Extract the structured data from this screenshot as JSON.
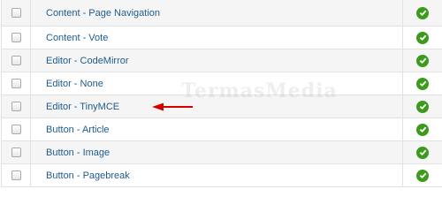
{
  "watermark": "TermasMedia",
  "status_color": "#3c9a1d",
  "link_color": "#1f5b8c",
  "arrow_color": "#d40000",
  "rows": [
    {
      "name": "Content - Page Navigation",
      "status_icon": "check-circle-icon"
    },
    {
      "name": "Content - Vote",
      "status_icon": "check-circle-icon"
    },
    {
      "name": "Editor - CodeMirror",
      "status_icon": "check-circle-icon"
    },
    {
      "name": "Editor - None",
      "status_icon": "check-circle-icon"
    },
    {
      "name": "Editor - TinyMCE",
      "status_icon": "check-circle-icon",
      "highlighted_by_arrow": true
    },
    {
      "name": "Button - Article",
      "status_icon": "check-circle-icon"
    },
    {
      "name": "Button - Image",
      "status_icon": "check-circle-icon"
    },
    {
      "name": "Button - Pagebreak",
      "status_icon": "check-circle-icon"
    }
  ]
}
